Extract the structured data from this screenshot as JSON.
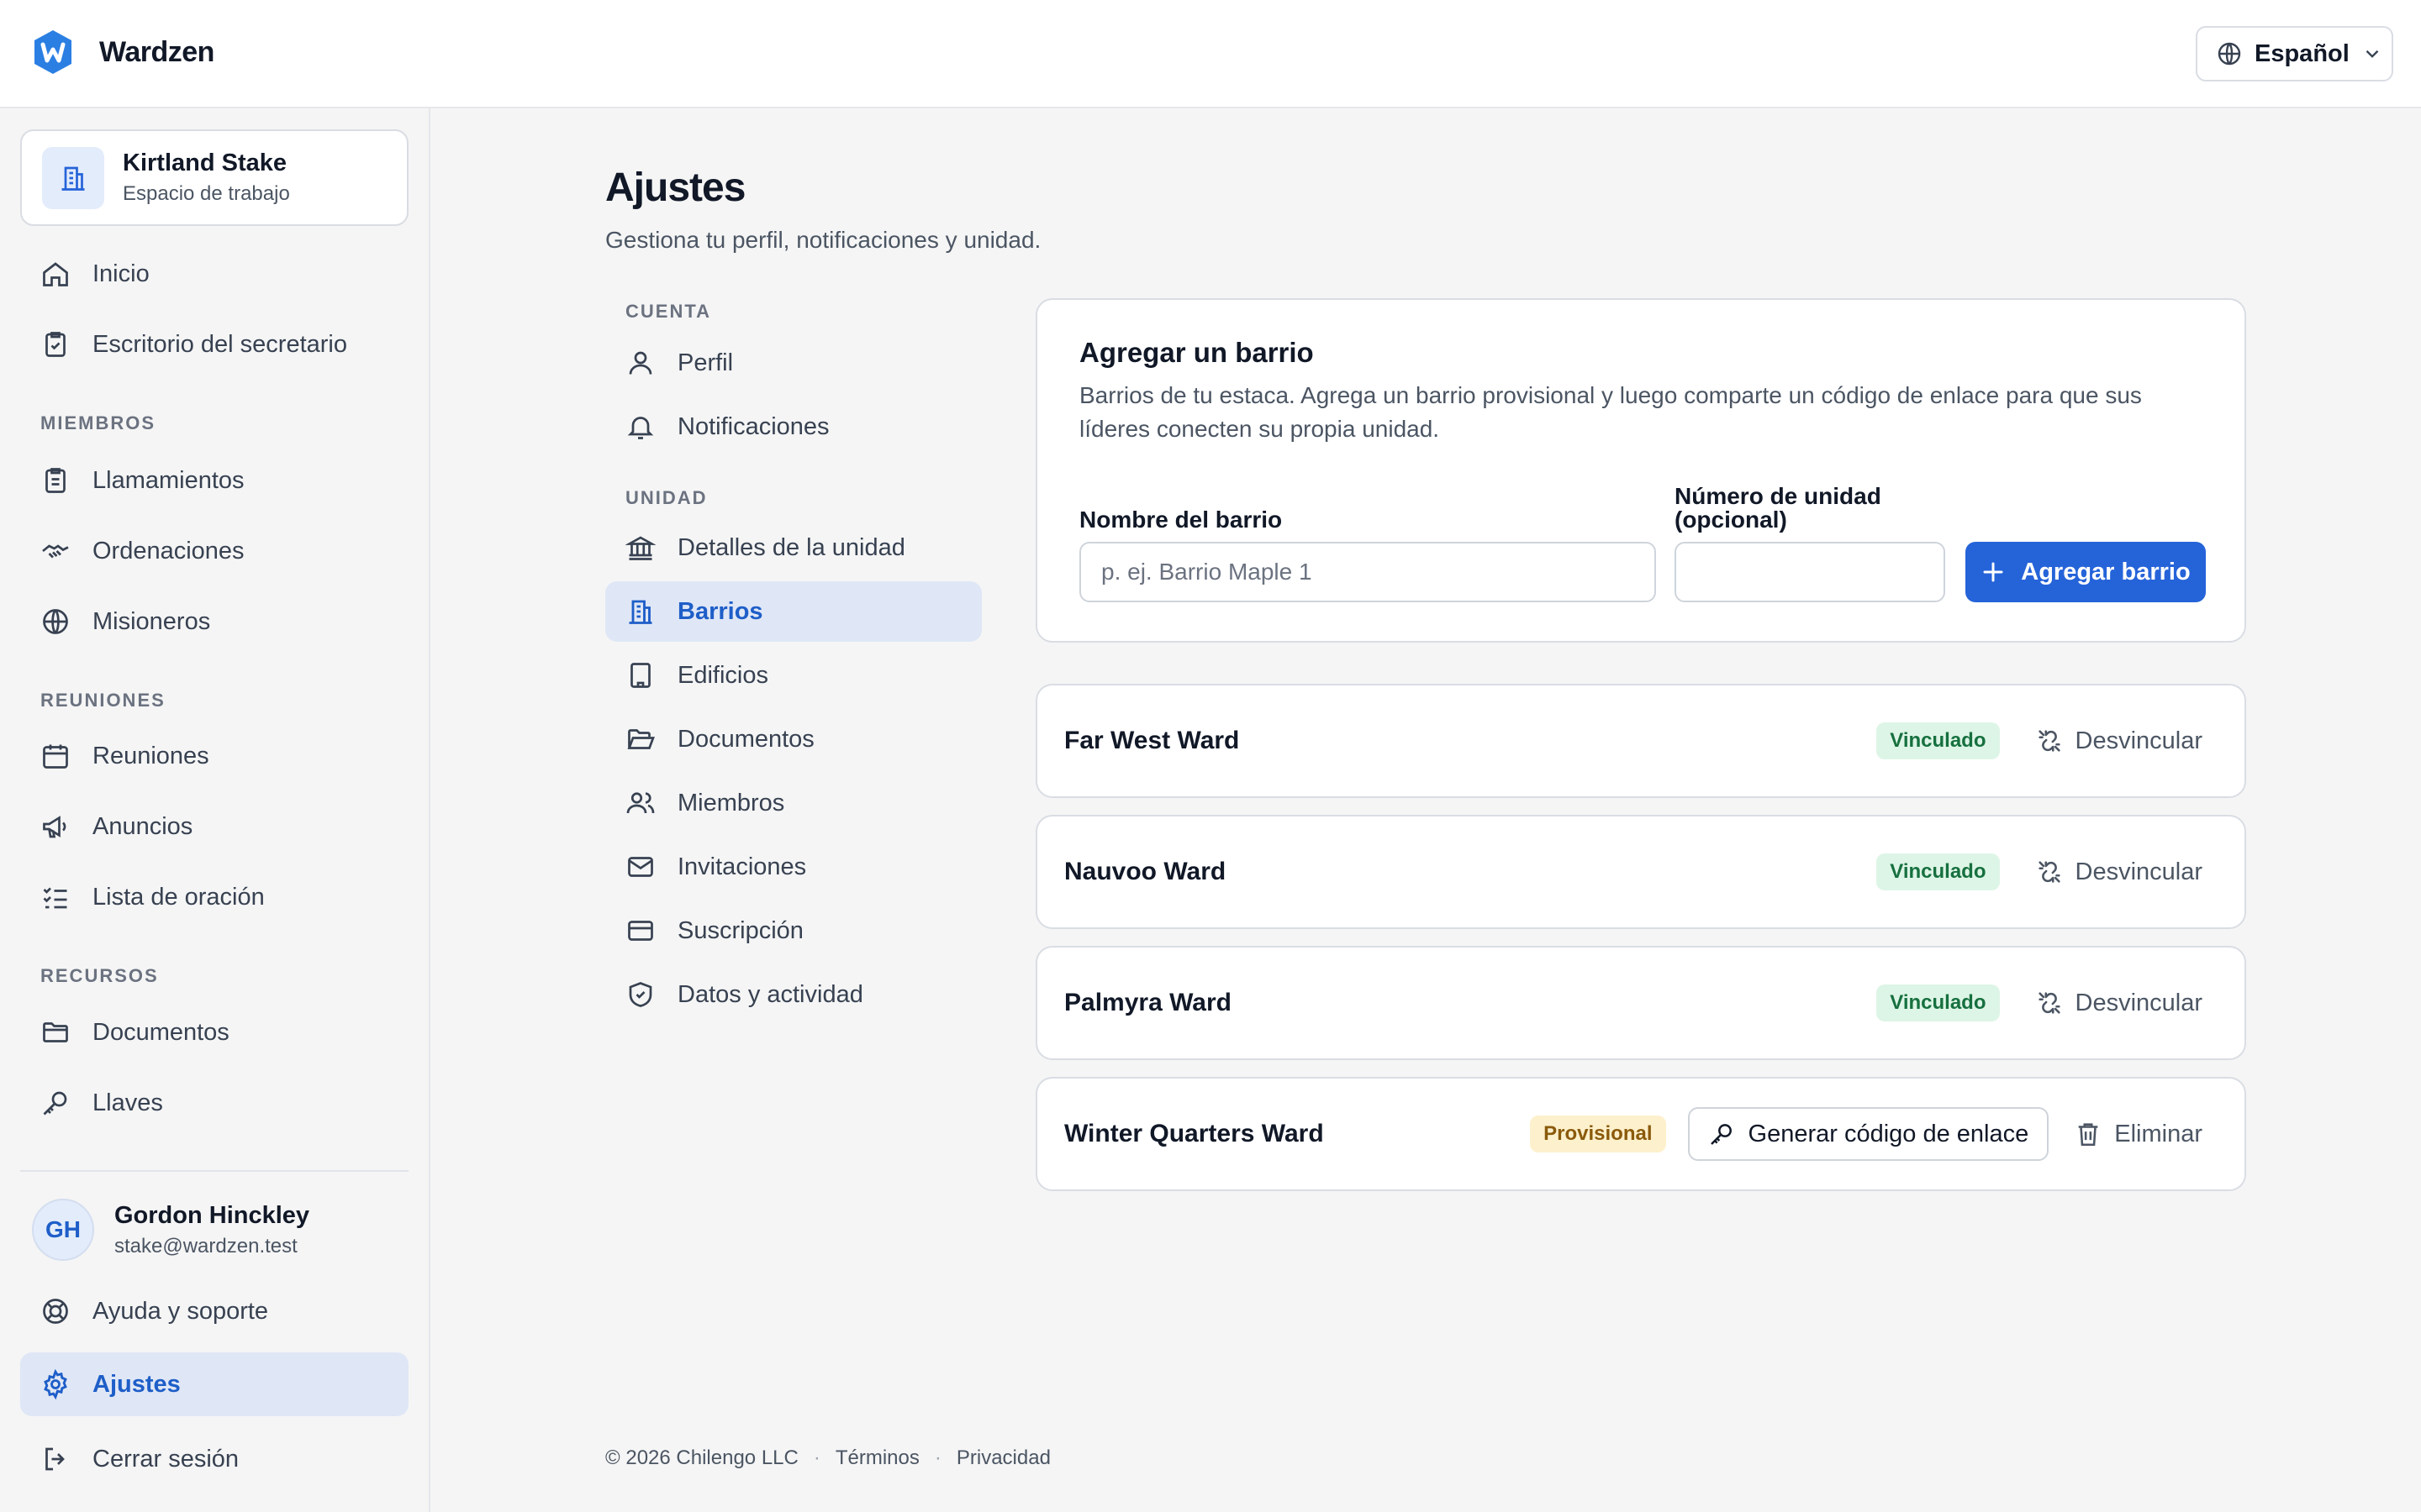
{
  "app": {
    "name": "Wardzen"
  },
  "language": {
    "selected": "Español"
  },
  "workspace": {
    "name": "Kirtland Stake",
    "subtitle": "Espacio de trabajo"
  },
  "sidebar": {
    "items": [
      {
        "label": "Inicio",
        "icon": "home-icon"
      },
      {
        "label": "Escritorio del secretario",
        "icon": "clipboard-check-icon"
      }
    ],
    "sections": [
      {
        "label": "MIEMBROS",
        "items": [
          {
            "label": "Llamamientos",
            "icon": "clipboard-list-icon"
          },
          {
            "label": "Ordenaciones",
            "icon": "handshake-icon"
          },
          {
            "label": "Misioneros",
            "icon": "globe-icon"
          }
        ]
      },
      {
        "label": "REUNIONES",
        "items": [
          {
            "label": "Reuniones",
            "icon": "calendar-icon"
          },
          {
            "label": "Anuncios",
            "icon": "megaphone-icon"
          },
          {
            "label": "Lista de oración",
            "icon": "list-checks-icon"
          }
        ]
      },
      {
        "label": "RECURSOS",
        "items": [
          {
            "label": "Documentos",
            "icon": "folder-icon"
          },
          {
            "label": "Llaves",
            "icon": "key-icon"
          }
        ]
      }
    ],
    "user": {
      "initials": "GH",
      "name": "Gordon Hinckley",
      "email": "stake@wardzen.test"
    },
    "bottom": [
      {
        "label": "Ayuda y soporte",
        "icon": "lifebuoy-icon"
      },
      {
        "label": "Ajustes",
        "icon": "gear-icon",
        "active": true
      },
      {
        "label": "Cerrar sesión",
        "icon": "logout-icon"
      }
    ]
  },
  "page": {
    "title": "Ajustes",
    "subtitle": "Gestiona tu perfil, notificaciones y unidad."
  },
  "settings_nav": {
    "account_label": "CUENTA",
    "account_items": [
      {
        "label": "Perfil",
        "icon": "user-icon"
      },
      {
        "label": "Notificaciones",
        "icon": "bell-icon"
      }
    ],
    "unit_label": "UNIDAD",
    "unit_items": [
      {
        "label": "Detalles de la unidad",
        "icon": "landmark-icon"
      },
      {
        "label": "Barrios",
        "icon": "buildings-icon",
        "active": true
      },
      {
        "label": "Edificios",
        "icon": "building-icon"
      },
      {
        "label": "Documentos",
        "icon": "folder-open-icon"
      },
      {
        "label": "Miembros",
        "icon": "users-icon"
      },
      {
        "label": "Invitaciones",
        "icon": "mail-icon"
      },
      {
        "label": "Suscripción",
        "icon": "credit-card-icon"
      },
      {
        "label": "Datos y actividad",
        "icon": "shield-check-icon"
      }
    ]
  },
  "add_ward": {
    "title": "Agregar un barrio",
    "description": "Barrios de tu estaca. Agrega un barrio provisional y luego comparte un código de enlace para que sus líderes conecten su propia unidad.",
    "name_label": "Nombre del barrio",
    "name_placeholder": "p. ej. Barrio Maple 1",
    "name_value": "",
    "unit_label_line1": "Número de unidad",
    "unit_label_line2": "(opcional)",
    "unit_value": "",
    "add_button": "Agregar barrio"
  },
  "wards": [
    {
      "name": "Far West Ward",
      "status": "Vinculado",
      "action": "Desvincular"
    },
    {
      "name": "Nauvoo Ward",
      "status": "Vinculado",
      "action": "Desvincular"
    },
    {
      "name": "Palmyra Ward",
      "status": "Vinculado",
      "action": "Desvincular"
    },
    {
      "name": "Winter Quarters Ward",
      "status": "Provisional",
      "action_primary": "Generar código de enlace",
      "action": "Eliminar"
    }
  ],
  "footer": {
    "copyright": "© 2026 Chilengo LLC",
    "terms": "Términos",
    "privacy": "Privacidad",
    "separator": "·"
  },
  "colors": {
    "accent": "#2563d9",
    "active_bg": "#dfe7f6",
    "linked_bg": "#ddf5e6",
    "provisional_bg": "#fdf0cc"
  }
}
